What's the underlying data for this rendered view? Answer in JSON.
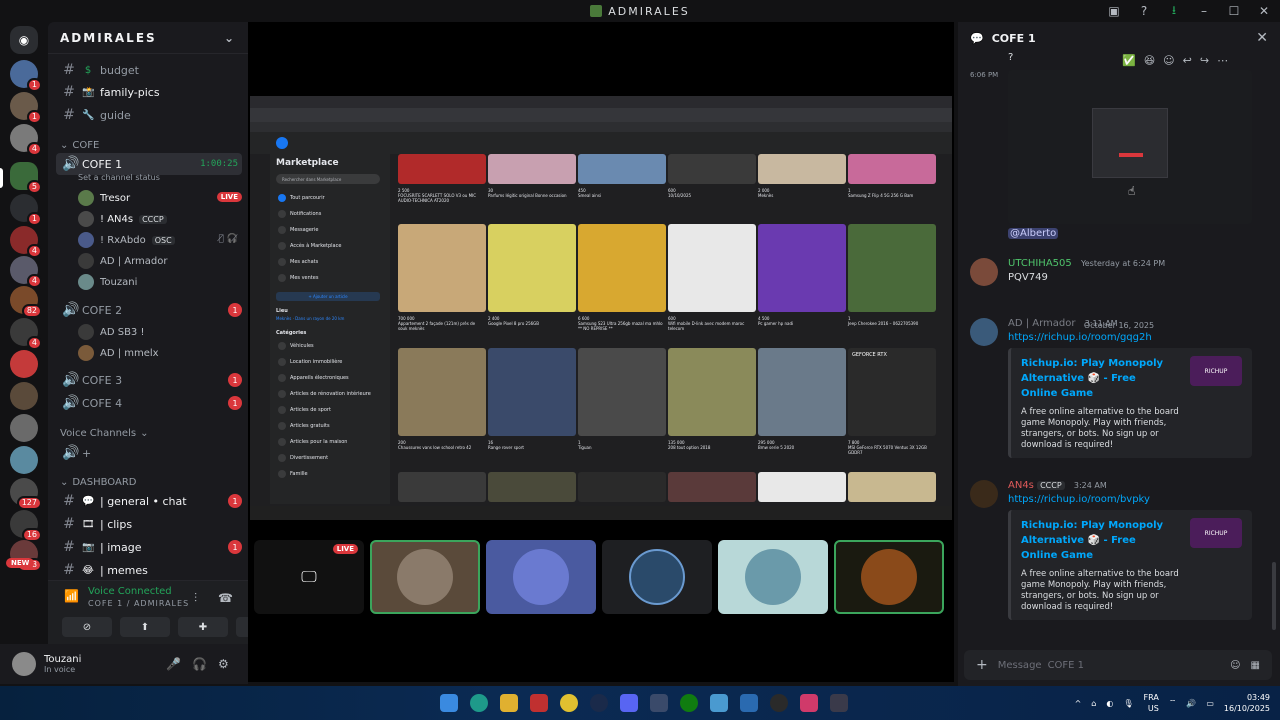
{
  "window": {
    "title": "ADMIRALES"
  },
  "server": {
    "name": "ADMIRALES",
    "guild_badges": [
      "1",
      "1",
      "4",
      "5",
      "1",
      "4",
      "4",
      "82",
      "4",
      "127",
      "16",
      "208"
    ],
    "new_label": "NEW"
  },
  "channels": {
    "top": [
      {
        "emoji": "$",
        "name": "budget"
      },
      {
        "emoji": "📸",
        "name": "family-pics"
      },
      {
        "emoji": "🔧",
        "name": "guide"
      }
    ],
    "category_cofe": "COFE",
    "voice1": {
      "name": "COFE 1",
      "timer": "1:00:25",
      "status": "Set a channel status"
    },
    "voice1_users": [
      {
        "name": "Tresor",
        "live": "LIVE"
      },
      {
        "name": "! AN4s",
        "tag": "CCCP"
      },
      {
        "name": "! RxAbdo",
        "tag": "OSC"
      },
      {
        "name": "AD | Armador"
      },
      {
        "name": "Touzani"
      }
    ],
    "voice2": {
      "name": "COFE 2",
      "badge": "1"
    },
    "voice2_users": [
      {
        "name": "AD SB3 !"
      },
      {
        "name": "AD | mmelx"
      }
    ],
    "voice3": {
      "name": "COFE 3",
      "badge": "1"
    },
    "voice4": {
      "name": "COFE 4",
      "badge": "1"
    },
    "voice_channels_cat": "Voice Channels",
    "dashboard_cat": "DASHBOARD",
    "dashboard": [
      {
        "name": "| general • chat",
        "badge": "1"
      },
      {
        "name": "| clips"
      },
      {
        "name": "| image",
        "badge": "1"
      },
      {
        "name": "| memes"
      }
    ]
  },
  "voice_panel": {
    "connected": "Voice Connected",
    "location": "COFE 1 / ADMIRALES"
  },
  "user_panel": {
    "name": "Touzani",
    "status": "In voice"
  },
  "stream": {
    "live_label": "LIVE",
    "marketplace_title": "Marketplace",
    "search_placeholder": "Rechercher dans Marketplace",
    "side_items": [
      "Tout parcourir",
      "Notifications",
      "Messagerie",
      "Accès à Marketplace",
      "Mes achats",
      "Mes ventes"
    ],
    "create_listing": "+ Ajouter un article",
    "location_head": "Lieu",
    "location": "Meknès · Dans un rayon de 20 km",
    "categories_head": "Catégories",
    "categories": [
      "Véhicules",
      "Location immobilière",
      "Appareils électroniques",
      "Articles de rénovation intérieure",
      "Articles de sport",
      "Articles gratuits",
      "Articles pour la maison",
      "Divertissement",
      "Famille"
    ],
    "row1": [
      {
        "price": "2 500",
        "label": "FOCUSRITE SCARLETT SOLO V3 ou MIC AUDIO-TECHNICA AT2020"
      },
      {
        "price": "30",
        "label": "Parfums légitic original Bonne occasion"
      },
      {
        "price": "450",
        "label": "Smeal ainsi"
      },
      {
        "price": "600",
        "label": "10/10/2025"
      },
      {
        "price": "2 000",
        "label": "Meknès"
      },
      {
        "price": "1",
        "label": "Samsung Z Flip 4 5G 256 G Bam"
      }
    ],
    "row2": [
      {
        "price": "700 000",
        "label": "Appartement 2 façade (121m) près de souk meknès"
      },
      {
        "price": "2 400",
        "label": "Google Pixel 8 pro 256GB"
      },
      {
        "price": "6 600",
        "label": "Samsung S23 Ultra 256gb mazal ma mhlo ** NO REPRISE **"
      },
      {
        "price": "600",
        "label": "Wifi mobile D-link avec modem maroc telecom"
      },
      {
        "price": "4 500",
        "label": "Pc gamer hp nadi"
      },
      {
        "price": "1",
        "label": "Jeep Cherokee 2016 – 0622705390"
      }
    ],
    "row3": [
      {
        "price": "200",
        "label": "Chaussures vans low school retro 42"
      },
      {
        "price": "16",
        "label": "Range rover sport"
      },
      {
        "price": "1",
        "label": "Tiguan"
      },
      {
        "price": "135 000",
        "label": "208 tout option 2018"
      },
      {
        "price": "295 000",
        "label": "Bmw serie 5 2020"
      },
      {
        "price": "7 800",
        "label": "MSI GeForce RTX 5070 Ventus 3X 12GB GDDR7"
      }
    ],
    "gpu_label": "GEFORCE RTX"
  },
  "right_panel": {
    "channel": "COFE 1",
    "first_line": "?",
    "first_time": "6:06 PM",
    "mention": "@Alberto",
    "messages": [
      {
        "author": "UTCHIHA505",
        "time": "Yesterday at 6:24 PM",
        "text": "PQV749",
        "color": "#4fc36b"
      },
      {
        "author": "AD | Armador",
        "time": "3:11 AM",
        "text": "https://richup.io/room/gqg2h",
        "color": "#7a7d85"
      },
      {
        "author": "AN4s",
        "tag": "CCCP",
        "time": "3:24 AM",
        "text": "https://richup.io/room/bvpky",
        "color": "#e05a5a"
      }
    ],
    "date_divider": "October 16, 2025",
    "embed_title": "Richup.io: Play Monopoly Alternative 🎲 - Free Online Game",
    "embed_desc": "A free online alternative to the board game Monopoly. Play with friends, strangers, or bots. No sign up or download is required!",
    "embed_logo": "RICHUP",
    "composer_placeholder": "Message",
    "composer_channel": "COFE 1"
  },
  "taskbar": {
    "lang1": "FRA",
    "lang2": "US",
    "time": "03:49",
    "date": "16/10/2025"
  }
}
